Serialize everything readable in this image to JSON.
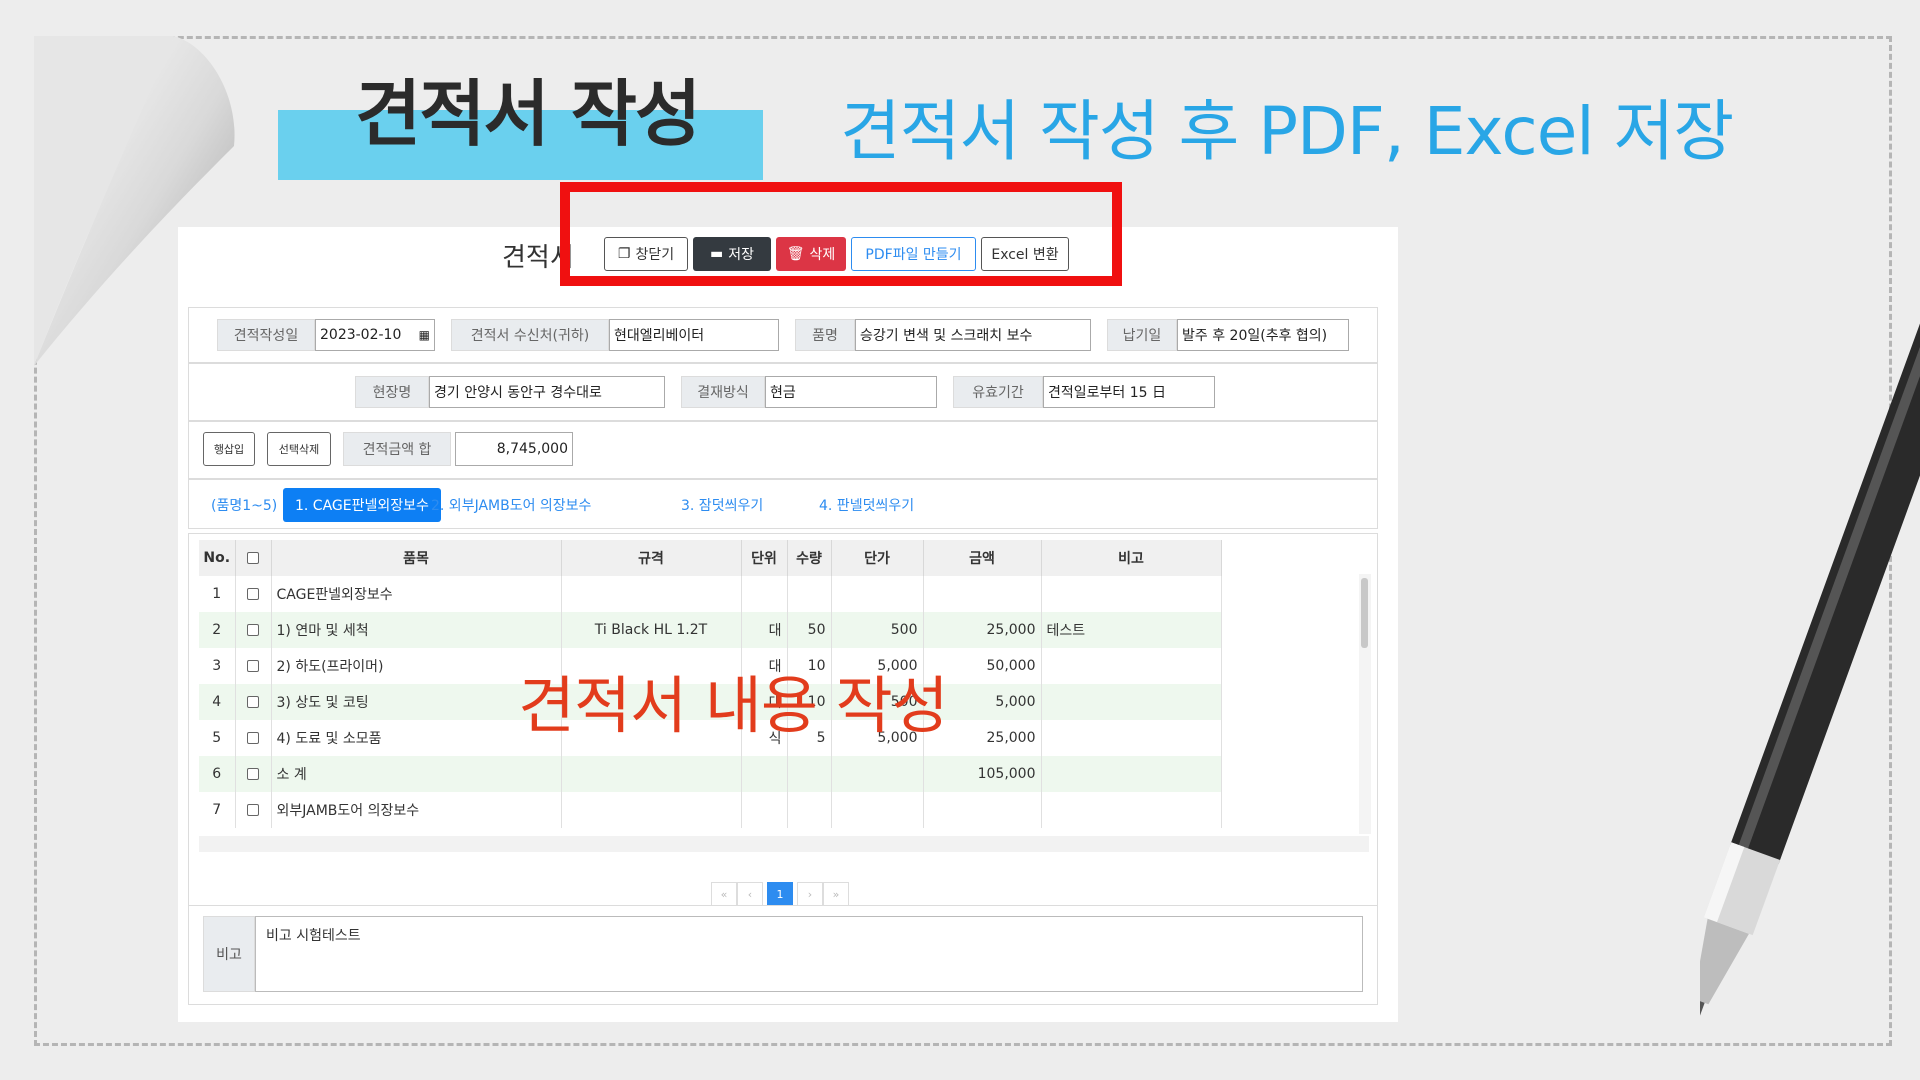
{
  "heading": {
    "title": "견적서 작성",
    "subtitle": "견적서 작성 후 PDF, Excel 저장"
  },
  "document": {
    "title": "견적서"
  },
  "toolbar": {
    "close_label": "창닫기",
    "save_label": "저장",
    "delete_label": "삭제",
    "pdf_label": "PDF파일 만들기",
    "excel_label": "Excel 변환"
  },
  "header_fields": {
    "date_label": "견적작성일",
    "date_value": "2023-02-10",
    "recipient_label": "견적서 수신처(귀하)",
    "recipient_value": "현대엘리베이터",
    "item_label": "품명",
    "item_value": "승강기 변색 및 스크래치 보수",
    "delivery_label": "납기일",
    "delivery_value": "발주 후 20일(추후 협의)",
    "site_label": "현장명",
    "site_value": "경기 안양시 동안구 경수대로",
    "payment_label": "결재방식",
    "payment_value": "현금",
    "validity_label": "유효기간",
    "validity_value": "견적일로부터 15 日"
  },
  "actions": {
    "insert_row_label": "행삽입",
    "delete_selected_label": "선택삭제",
    "total_label": "견적금액 합",
    "total_value": "8,745,000"
  },
  "tabs": [
    {
      "label": "(품명1~5)",
      "active": false
    },
    {
      "label": "1. CAGE판넬외장보수",
      "active": true
    },
    {
      "label": "2. 외부JAMB도어 의장보수",
      "active": false
    },
    {
      "label": "3. 잠덧씌우기",
      "active": false
    },
    {
      "label": "4. 판넬덧씌우기",
      "active": false
    }
  ],
  "grid": {
    "columns": [
      "No.",
      "",
      "품목",
      "규격",
      "단위",
      "수량",
      "단가",
      "금액",
      "비고"
    ],
    "rows": [
      {
        "no": "1",
        "item": "CAGE판넬외장보수",
        "spec": "",
        "unit": "",
        "qty": "",
        "price": "",
        "amount": "",
        "note": ""
      },
      {
        "no": "2",
        "item": "1) 연마 및 세척",
        "spec": "Ti Black HL 1.2T",
        "unit": "대",
        "qty": "50",
        "price": "500",
        "amount": "25,000",
        "note": "테스트"
      },
      {
        "no": "3",
        "item": "2) 하도(프라이머)",
        "spec": "",
        "unit": "대",
        "qty": "10",
        "price": "5,000",
        "amount": "50,000",
        "note": ""
      },
      {
        "no": "4",
        "item": "3) 상도 및 코팅",
        "spec": "",
        "unit": "대",
        "qty": "10",
        "price": "500",
        "amount": "5,000",
        "note": ""
      },
      {
        "no": "5",
        "item": "4) 도료 및 소모품",
        "spec": "",
        "unit": "식",
        "qty": "5",
        "price": "5,000",
        "amount": "25,000",
        "note": ""
      },
      {
        "no": "6",
        "item": "소 계",
        "spec": "",
        "unit": "",
        "qty": "",
        "price": "",
        "amount": "105,000",
        "note": ""
      },
      {
        "no": "7",
        "item": "외부JAMB도어 의장보수",
        "spec": "",
        "unit": "",
        "qty": "",
        "price": "",
        "amount": "",
        "note": ""
      }
    ]
  },
  "pagination": {
    "first": "«",
    "prev": "‹",
    "current": "1",
    "next": "›",
    "last": "»"
  },
  "overlay": {
    "text": "견적서 내용 작성"
  },
  "remarks": {
    "label": "비고",
    "value": "비고 시험테스트"
  },
  "colors": {
    "accent_blue": "#29a6e6",
    "callout_red": "#f01010",
    "overlay_red": "#e23c1c",
    "heading_bar": "#6ad0ee"
  }
}
